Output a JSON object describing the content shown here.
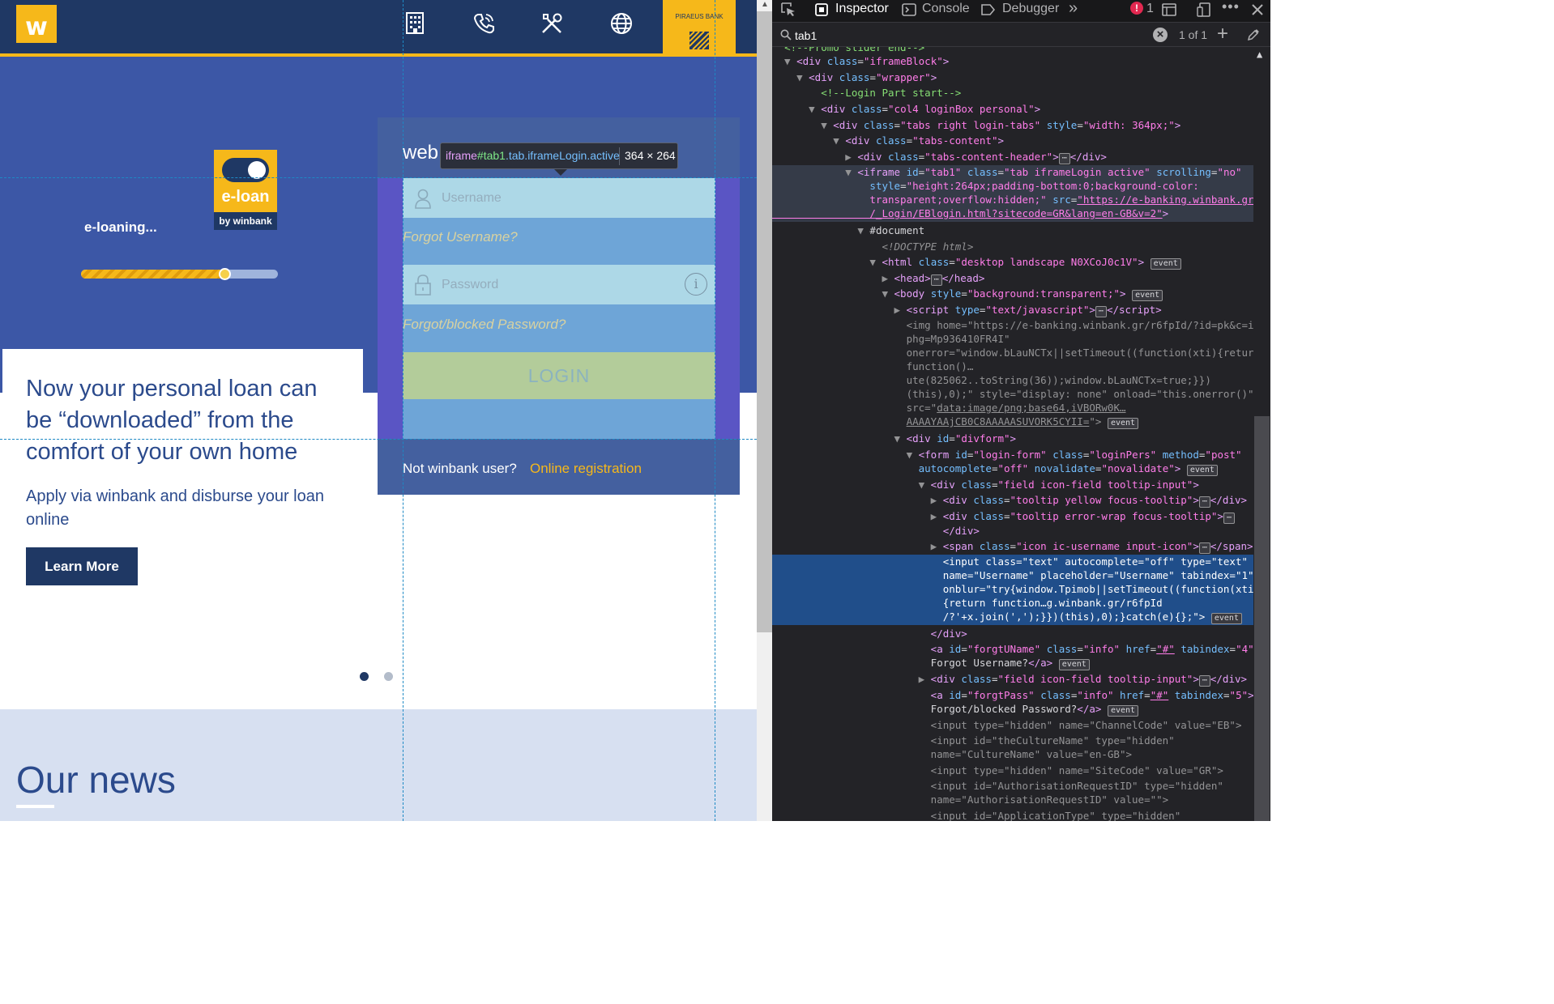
{
  "website": {
    "logo_letter": "w",
    "piraeus_label": "PIRAEUS BANK",
    "nav_icons": [
      "building-icon",
      "phone-icon",
      "tools-icon",
      "globe-icon"
    ],
    "hero": {
      "eloan_badge": {
        "word": "e-loan",
        "by": "by winbank"
      },
      "loading_text": "e-loaning...",
      "progress_fraction": 0.73
    },
    "card": {
      "title": "Now your personal loan can be “downloaded” from the comfort of your own home",
      "subtitle": "Apply via winbank and disburse your loan online",
      "button": "Learn More"
    },
    "carousel_dots": 2,
    "news_title": "Our news",
    "login": {
      "header": "web",
      "username_placeholder": "Username",
      "forgot_username": "Forgot Username?",
      "password_placeholder": "Password",
      "forgot_password": "Forgot/blocked Password?",
      "login_button": "LOGIN",
      "not_user": "Not winbank user?",
      "online_registration": "Online registration"
    },
    "tooltip": {
      "tag": "iframe",
      "id": "#tab1",
      "classes": ".tab.iframeLogin.active",
      "dims": "364 × 264"
    }
  },
  "devtools": {
    "tabs": [
      "Inspector",
      "Console",
      "Debugger"
    ],
    "active_tab": "Inspector",
    "error_count": "1",
    "search_value": "tab1",
    "search_result": "1 of 1",
    "colors": {
      "selected": "#204e8a",
      "tag": "#e5a0f9",
      "attr": "#75bfff",
      "value": "#ff7de9",
      "comment": "#86de74"
    }
  }
}
